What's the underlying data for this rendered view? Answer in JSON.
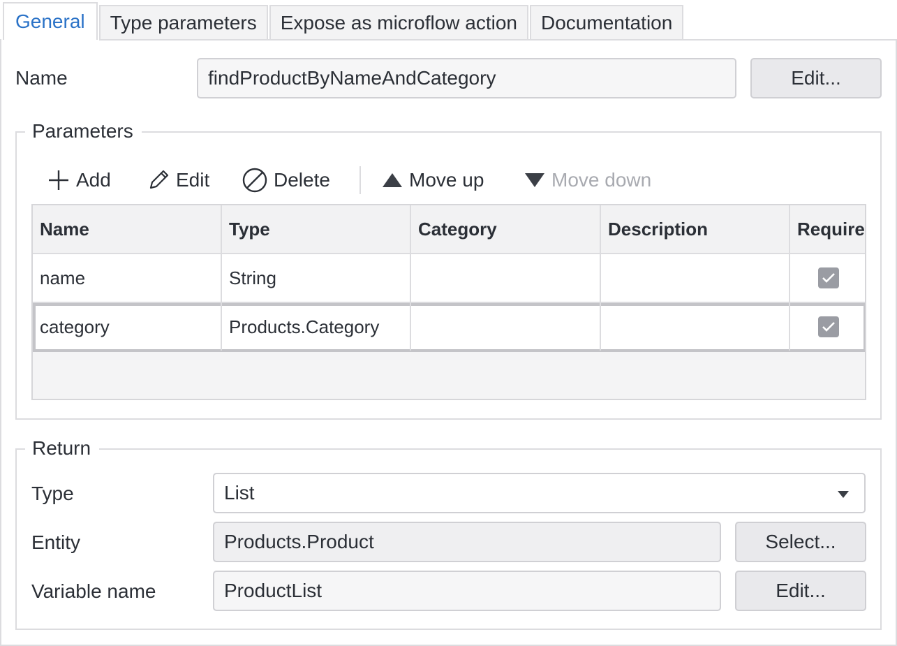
{
  "tabs": [
    {
      "label": "General",
      "active": true
    },
    {
      "label": "Type parameters",
      "active": false
    },
    {
      "label": "Expose as microflow action",
      "active": false
    },
    {
      "label": "Documentation",
      "active": false
    }
  ],
  "name_row": {
    "label": "Name",
    "value": "findProductByNameAndCategory",
    "edit_label": "Edit..."
  },
  "parameters": {
    "title": "Parameters",
    "toolbar": {
      "add": "Add",
      "edit": "Edit",
      "delete": "Delete",
      "move_up": "Move up",
      "move_down": "Move down"
    },
    "columns": [
      "Name",
      "Type",
      "Category",
      "Description",
      "Require"
    ],
    "rows": [
      {
        "name": "name",
        "type": "String",
        "category": "",
        "description": "",
        "required": true
      },
      {
        "name": "category",
        "type": "Products.Category",
        "category": "",
        "description": "",
        "required": true
      }
    ]
  },
  "return": {
    "title": "Return",
    "type_label": "Type",
    "type_value": "List",
    "entity_label": "Entity",
    "entity_value": "Products.Product",
    "entity_button": "Select...",
    "variable_label": "Variable name",
    "variable_value": "ProductList",
    "variable_button": "Edit..."
  },
  "colors": {
    "accent": "#2a72c7",
    "border": "#dcdcdf",
    "disabled": "#a8aab0"
  }
}
